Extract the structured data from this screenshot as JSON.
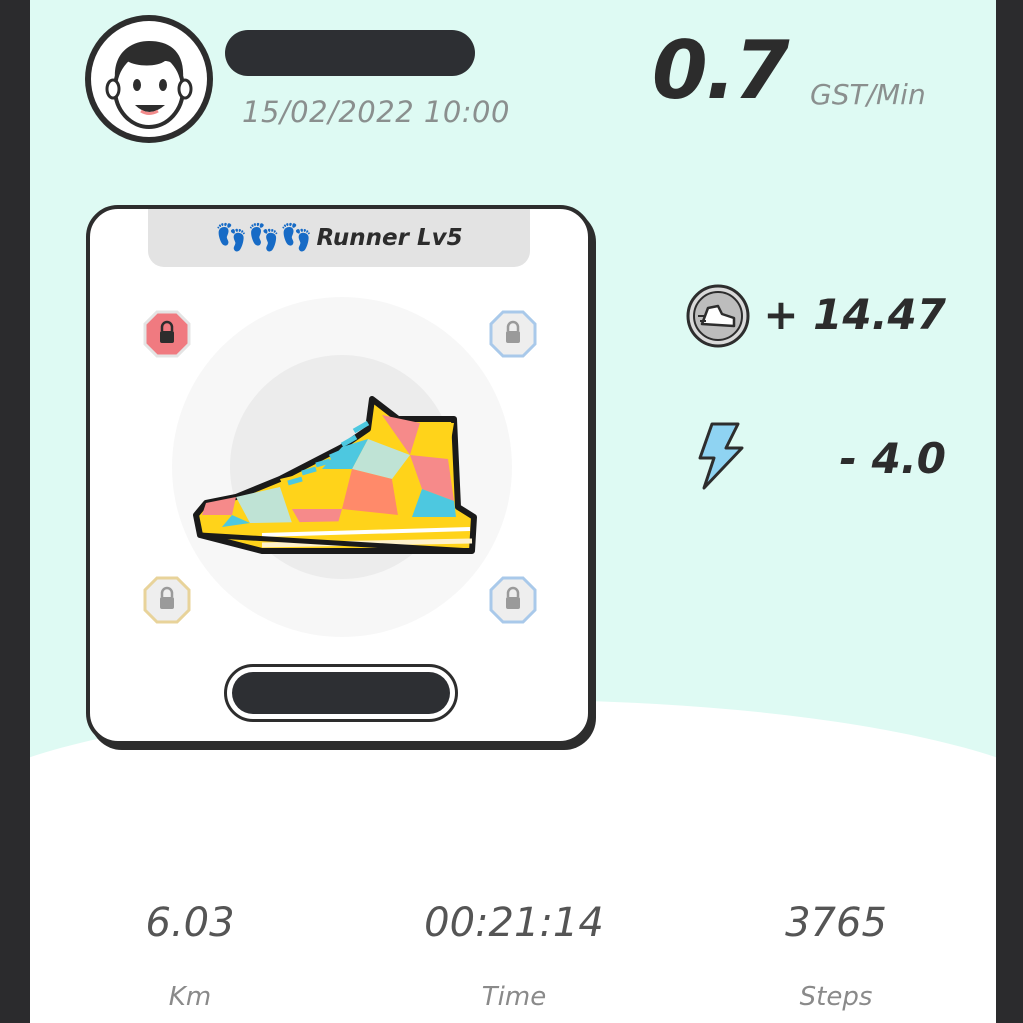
{
  "header": {
    "date": "15/02/2022 10:00",
    "rate_value": "0.7",
    "rate_unit": "GST/Min"
  },
  "sneaker": {
    "level_label": "Runner Lv5",
    "footprints": "👣👣👣",
    "sockets": [
      {
        "name": "socket-top-left",
        "color": "#f07a80"
      },
      {
        "name": "socket-top-right",
        "color": "#a9c9ea"
      },
      {
        "name": "socket-bottom-left",
        "color": "#e8d39a"
      },
      {
        "name": "socket-bottom-right",
        "color": "#a9c9ea"
      }
    ]
  },
  "earnings": {
    "gst": "+ 14.47",
    "energy": "- 4.0"
  },
  "stats": [
    {
      "value": "6.03",
      "label": "Km"
    },
    {
      "value": "00:21:14",
      "label": "Time"
    },
    {
      "value": "3765",
      "label": "Steps"
    }
  ],
  "colors": {
    "mint_background": "#defaf3",
    "dark": "#2d2d2d",
    "energy_blue": "#8fd3f2"
  },
  "icons": [
    "avatar",
    "footprint-icon",
    "sneaker-image",
    "lock-icon",
    "gst-coin-icon",
    "energy-bolt-icon"
  ]
}
